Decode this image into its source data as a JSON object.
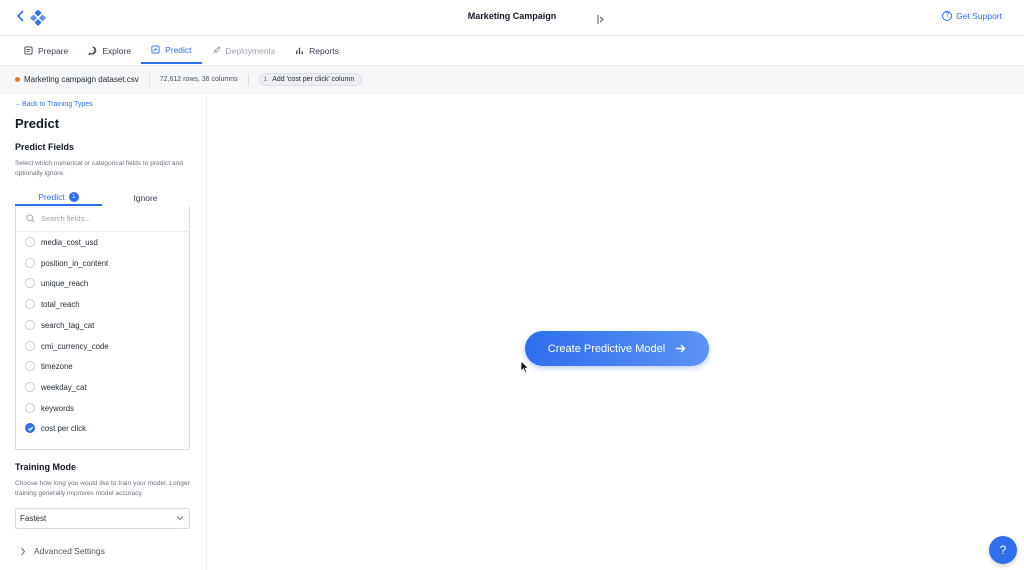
{
  "header": {
    "app_title": "Marketing Campaign",
    "support_label": "Get Support"
  },
  "nav": {
    "tabs": [
      {
        "label": "Prepare",
        "icon": "prepare-icon"
      },
      {
        "label": "Explore",
        "icon": "explore-icon"
      },
      {
        "label": "Predict",
        "icon": "predict-icon",
        "active": true
      },
      {
        "label": "Deployments",
        "icon": "rocket-icon",
        "disabled": true
      },
      {
        "label": "Reports",
        "icon": "bar-chart-icon"
      }
    ]
  },
  "dataset": {
    "name": "Marketing campaign dataset.csv",
    "meta": "72,612 rows, 36 columns",
    "step_number": "1",
    "step_label": "Add 'cost per click' column"
  },
  "panel": {
    "back_link": "←Back to Training Types",
    "title": "Predict",
    "fields_heading": "Predict Fields",
    "fields_desc": "Select which numerical or categorical fields to predict and optionally ignore.",
    "subtabs": {
      "predict": "Predict",
      "predict_count": "1",
      "ignore": "Ignore"
    },
    "search_placeholder": "Search fields...",
    "fields": [
      {
        "name": "media_cost_usd",
        "checked": false
      },
      {
        "name": "position_in_content",
        "checked": false
      },
      {
        "name": "unique_reach",
        "checked": false
      },
      {
        "name": "total_reach",
        "checked": false
      },
      {
        "name": "search_tag_cat",
        "checked": false
      },
      {
        "name": "cmi_currency_code",
        "checked": false
      },
      {
        "name": "timezone",
        "checked": false
      },
      {
        "name": "weekday_cat",
        "checked": false
      },
      {
        "name": "keywords",
        "checked": false
      },
      {
        "name": "cost per click",
        "checked": true
      }
    ],
    "training_heading": "Training Mode",
    "training_desc": "Choose how long you would like to train your model. Longer training generally improves model accuracy.",
    "training_value": "Fastest",
    "advanced_label": "Advanced Settings"
  },
  "main": {
    "cta_label": "Create Predictive Model"
  },
  "help_label": "?",
  "colors": {
    "accent": "#2f6fed",
    "dataset_dot": "#e8762b"
  }
}
